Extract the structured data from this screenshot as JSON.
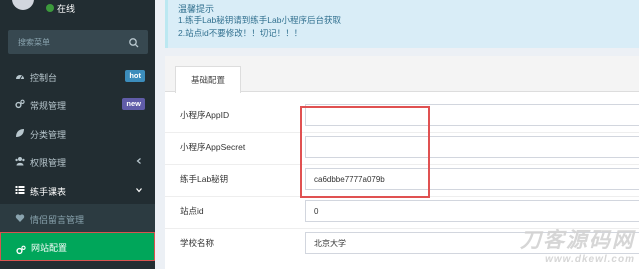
{
  "sidebar": {
    "status": "在线",
    "search_placeholder": "搜索菜单",
    "menu": [
      {
        "label": "控制台",
        "badge": "hot"
      },
      {
        "label": "常规管理",
        "badge": "new"
      },
      {
        "label": "分类管理"
      },
      {
        "label": "权限管理"
      },
      {
        "label": "练手课表"
      },
      {
        "label": "情侣留言管理"
      },
      {
        "label": "网站配置"
      }
    ]
  },
  "callout": {
    "title": "温馨提示",
    "line1": "1.练手Lab秘钥请到练手Lab小程序后台获取",
    "line2": "2.站点id不要修改！！切记！！！"
  },
  "tabs": [
    "基础配置"
  ],
  "form": [
    {
      "label": "小程序AppID",
      "value": ""
    },
    {
      "label": "小程序AppSecret",
      "value": ""
    },
    {
      "label": "练手Lab秘钥",
      "value": "ca6dbbe7777a079b"
    },
    {
      "label": "站点id",
      "value": "0"
    },
    {
      "label": "学校名称",
      "value": "北京大学"
    }
  ],
  "watermark": {
    "main": "刀客源码网",
    "url": "www.dkewl.com"
  },
  "colors": {
    "sidebar_bg": "#222d32",
    "active_bg": "#00a65a",
    "highlight": "#e05151",
    "callout_bg": "#d9edf7"
  }
}
